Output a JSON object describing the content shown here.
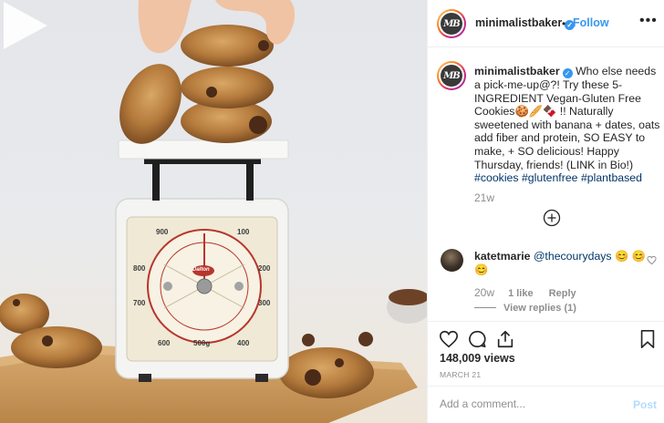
{
  "post": {
    "username": "minimalistbaker",
    "avatar_text": "MB",
    "follow_label": "Follow",
    "separator": "•",
    "more_label": "•••"
  },
  "caption": {
    "username": "minimalistbaker",
    "text_1": "Who else needs a pick-me-up@?! Try these 5-INGREDIENT Vegan-Gluten Free Cookies",
    "text_2": "!! Naturally sweetened with banana + dates, oats add fiber and protein, SO EASY to make, + SO delicious! Happy Thursday, friends! (LINK in Bio!)",
    "hashtags": [
      "#cookies",
      "#glutenfree",
      "#plantbased"
    ],
    "time": "21w"
  },
  "comment": {
    "username": "katetmarie",
    "mention": "@thecourydays",
    "emoji": "😊 😊 😊",
    "time": "20w",
    "likes": "1 like",
    "reply_label": "Reply",
    "view_replies": "View replies (1)"
  },
  "stats": {
    "views": "148,009 views",
    "date": "MARCH 21"
  },
  "composer": {
    "placeholder": "Add a comment...",
    "post_label": "Post"
  },
  "scale": {
    "brand": "Dalton",
    "readout": "500g",
    "numbers": [
      "900",
      "100",
      "800",
      "200",
      "700",
      "300",
      "600",
      "400"
    ]
  },
  "colors": {
    "accent": "#3897f0",
    "hashtag": "#003569",
    "muted": "#8e8e8e"
  }
}
